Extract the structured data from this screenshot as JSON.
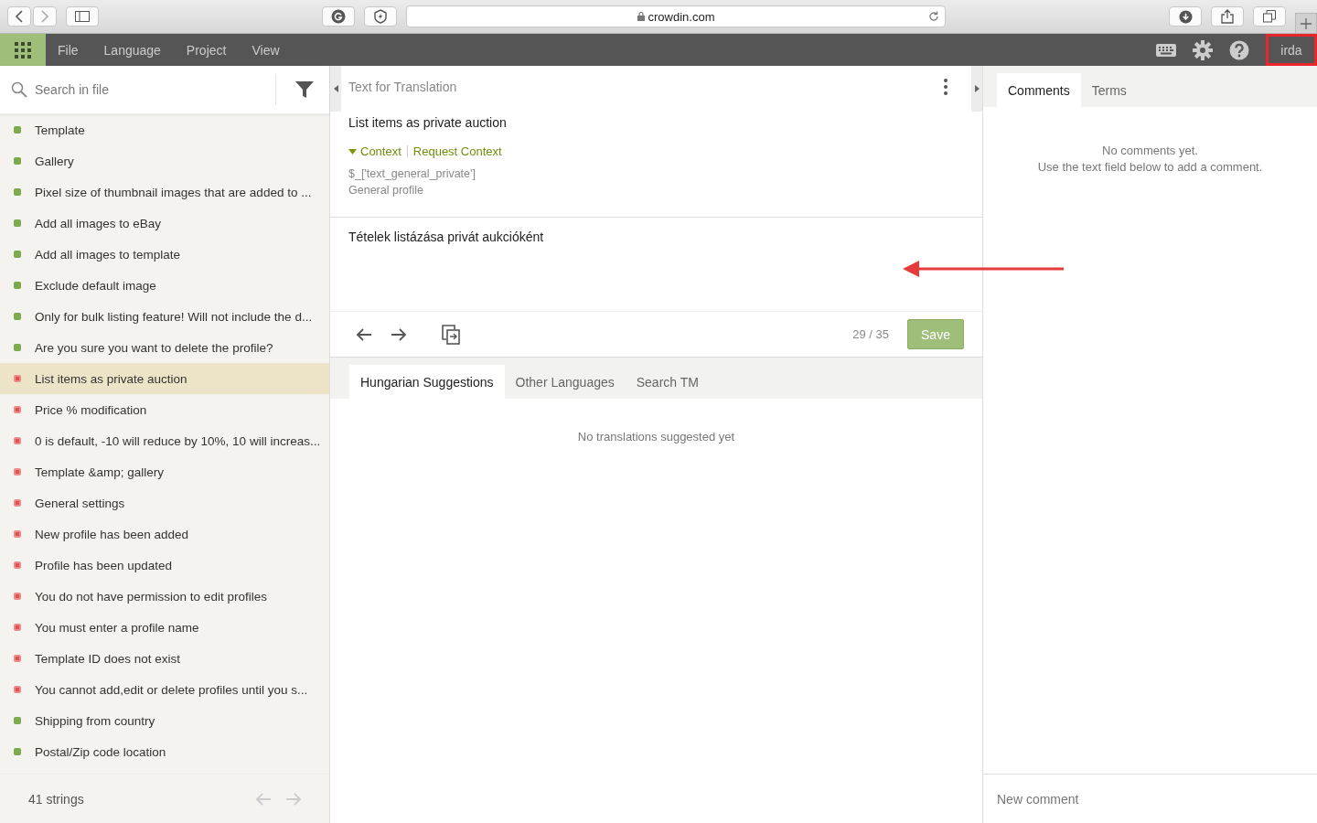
{
  "browser": {
    "url": "crowdin.com"
  },
  "menu": {
    "items": [
      "File",
      "Language",
      "Project",
      "View"
    ],
    "user": {
      "label": "irda",
      "highlighted": true
    }
  },
  "sidebar": {
    "search": {
      "placeholder": "Search in file"
    },
    "strings": [
      {
        "text": "Template",
        "translated": true,
        "selected": false
      },
      {
        "text": "Gallery",
        "translated": true,
        "selected": false
      },
      {
        "text": "Pixel size of thumbnail images that are added to ...",
        "translated": true,
        "selected": false
      },
      {
        "text": "Add all images to eBay",
        "translated": true,
        "selected": false
      },
      {
        "text": "Add all images to template",
        "translated": true,
        "selected": false
      },
      {
        "text": "Exclude default image",
        "translated": true,
        "selected": false
      },
      {
        "text": "Only for bulk listing feature! Will not include the d...",
        "translated": true,
        "selected": false
      },
      {
        "text": "Are you sure you want to delete the profile?",
        "translated": true,
        "selected": false
      },
      {
        "text": "List items as private auction",
        "translated": false,
        "selected": true
      },
      {
        "text": "Price % modification",
        "translated": false,
        "selected": false
      },
      {
        "text": "0 is default, -10 will reduce by 10%, 10 will increas...",
        "translated": false,
        "selected": false
      },
      {
        "text": "Template &amp; gallery",
        "translated": false,
        "selected": false
      },
      {
        "text": "General settings",
        "translated": false,
        "selected": false
      },
      {
        "text": "New profile has been added",
        "translated": false,
        "selected": false
      },
      {
        "text": "Profile has been updated",
        "translated": false,
        "selected": false
      },
      {
        "text": "You do not have permission to edit profiles",
        "translated": false,
        "selected": false
      },
      {
        "text": "You must enter a profile name",
        "translated": false,
        "selected": false
      },
      {
        "text": "Template ID does not exist",
        "translated": false,
        "selected": false
      },
      {
        "text": "You cannot add,edit or delete profiles until you s...",
        "translated": false,
        "selected": false
      },
      {
        "text": "Shipping from country",
        "translated": true,
        "selected": false
      },
      {
        "text": "Postal/Zip code location",
        "translated": true,
        "selected": false
      }
    ],
    "count": "41 strings"
  },
  "editor": {
    "title": "Text for Translation",
    "source": "List items as private auction",
    "context": {
      "label": "Context",
      "expanded": true,
      "request": "Request Context",
      "lines": [
        "$_['text_general_private']",
        "General profile"
      ]
    },
    "translation": "Tételek listázása privát aukcióként",
    "counter": "29 / 35",
    "save": "Save",
    "tabs": [
      {
        "label": "Hungarian Suggestions",
        "selected": true
      },
      {
        "label": "Other Languages",
        "selected": false
      },
      {
        "label": "Search TM",
        "selected": false
      }
    ],
    "empty": "No translations suggested yet"
  },
  "comments": {
    "tabs": [
      {
        "label": "Comments",
        "selected": true
      },
      {
        "label": "Terms",
        "selected": false
      }
    ],
    "empty": [
      "No comments yet.",
      "Use the text field below to add a comment."
    ],
    "placeholder": "New comment"
  }
}
